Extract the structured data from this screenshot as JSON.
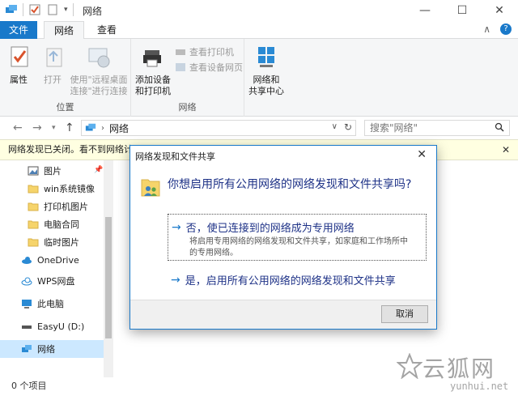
{
  "window": {
    "title": "网络",
    "controls": {
      "minimize": "—",
      "maximize": "☐",
      "close": "✕"
    }
  },
  "ribbon": {
    "tabs": {
      "file": "文件",
      "network": "网络",
      "view": "查看"
    },
    "help_collapse": "∧",
    "help": "?",
    "groups": {
      "location": {
        "label": "位置",
        "properties": "属性",
        "open": "打开",
        "remote_desktop_line1": "使用\"远程桌面",
        "remote_desktop_line2": "连接\"进行连接"
      },
      "network": {
        "label": "网络",
        "add_devices_line1": "添加设备",
        "add_devices_line2": "和打印机",
        "view_printers": "查看打印机",
        "view_device_page": "查看设备网页",
        "network_center_line1": "网络和",
        "network_center_line2": "共享中心"
      }
    }
  },
  "address": {
    "path": "网络",
    "search_placeholder": "搜索\"网络\""
  },
  "infobar": {
    "text": "网络发现已关闭。看不到网络计",
    "close": "✕"
  },
  "nav": {
    "items": [
      {
        "label": "图片"
      },
      {
        "label": "win系统镜像"
      },
      {
        "label": "打印机图片"
      },
      {
        "label": "电脑合同"
      },
      {
        "label": "临时图片"
      },
      {
        "label": "OneDrive"
      },
      {
        "label": "WPS网盘"
      },
      {
        "label": "此电脑"
      },
      {
        "label": "EasyU (D:)"
      },
      {
        "label": "网络"
      }
    ]
  },
  "status": {
    "item_count": "0 个项目"
  },
  "dialog": {
    "title": "网络发现和文件共享",
    "close": "✕",
    "question": "你想启用所有公用网络的网络发现和文件共享吗?",
    "option_private": {
      "title": "否，使已连接到的网络成为专用网络",
      "desc_line1": "将启用专用网络的网络发现和文件共享，如家庭和工作场所中",
      "desc_line2": "的专用网络。"
    },
    "option_public": {
      "title": "是，启用所有公用网络的网络发现和文件共享"
    },
    "cancel": "取消"
  },
  "watermark": {
    "text": "云狐网",
    "sub": "yunhui.net"
  },
  "colors": {
    "accent": "#1979ca",
    "dialog_text": "#1e3287",
    "infobar_bg": "#ffffe1",
    "selected_bg": "#cce8ff"
  }
}
